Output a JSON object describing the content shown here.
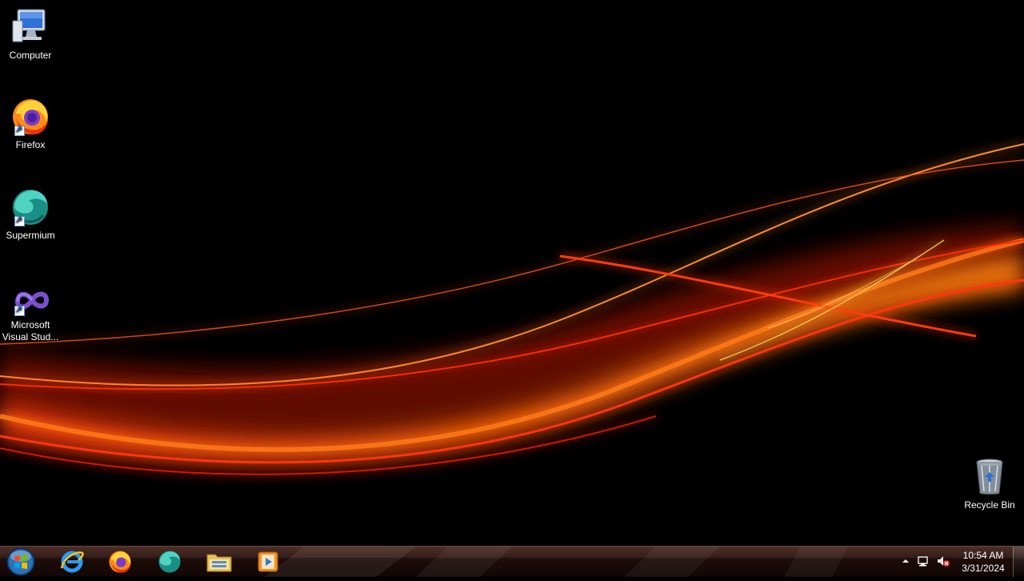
{
  "desktop": {
    "icons": [
      {
        "label": "Computer",
        "icon": "computer-icon"
      },
      {
        "label": "Firefox",
        "icon": "firefox-icon"
      },
      {
        "label": "Supermium",
        "icon": "supermium-icon"
      },
      {
        "label": "Microsoft Visual Stud...",
        "icon": "visual-studio-icon"
      },
      {
        "label": "Recycle Bin",
        "icon": "recycle-bin-icon"
      }
    ]
  },
  "taskbar": {
    "start_icon": "windows-start-orb-icon",
    "pinned": [
      {
        "name": "Internet Explorer",
        "icon": "internet-explorer-icon"
      },
      {
        "name": "Firefox",
        "icon": "firefox-icon"
      },
      {
        "name": "Supermium",
        "icon": "supermium-icon"
      },
      {
        "name": "Windows Explorer",
        "icon": "folder-icon"
      },
      {
        "name": "Windows Media Player",
        "icon": "media-player-icon"
      }
    ],
    "tray": {
      "icons": [
        "show-hidden-icons-icon",
        "network-icon",
        "volume-muted-icon"
      ],
      "time": "10:54 AM",
      "date": "3/31/2024"
    }
  },
  "colors": {
    "wallpaper_bg": "#000000",
    "wave_red": "#e8200a",
    "wave_orange": "#ff6a00",
    "wave_yellow": "#ffd35a"
  }
}
